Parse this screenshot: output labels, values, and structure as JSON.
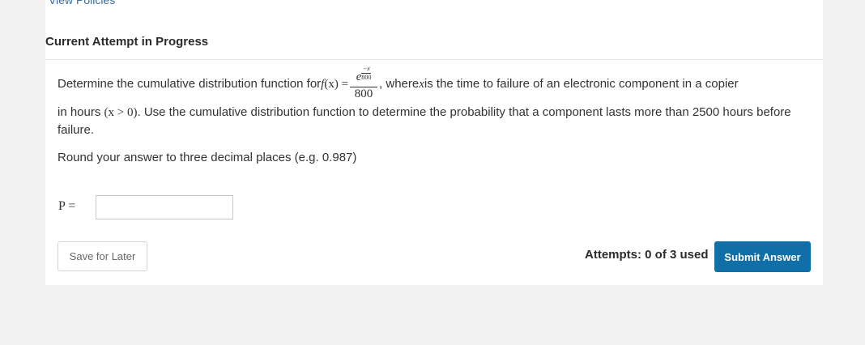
{
  "nav": {
    "view_policies": "View Policies"
  },
  "section": {
    "title": "Current Attempt in Progress"
  },
  "question": {
    "line1_prefix": "Determine the cumulative distribution function for ",
    "func_f": "f",
    "func_arg": " (x) = ",
    "frac_num_base": "e",
    "frac_num_exp_top": "−x",
    "frac_num_exp_bottom": "800",
    "frac_den": "800",
    "line1_suffix": ", where ",
    "var_x": "x",
    "line1_tail": " is the time to failure of an electronic component in a copier",
    "line2_prefix": "in hours ",
    "line2_math": "(x > 0)",
    "line2_suffix": ". Use the cumulative distribution function to determine the probability that a component lasts more than 2500 hours before failure."
  },
  "instructions": {
    "round": "Round your answer to three decimal places (e.g. 0.987)"
  },
  "answer": {
    "label": "P =",
    "value": ""
  },
  "footer": {
    "save_label": "Save for Later",
    "attempts_text": "Attempts: 0 of 3 used",
    "submit_label": "Submit Answer"
  },
  "colors": {
    "accent": "#0f6fa6",
    "background": "#f2f2f2"
  }
}
